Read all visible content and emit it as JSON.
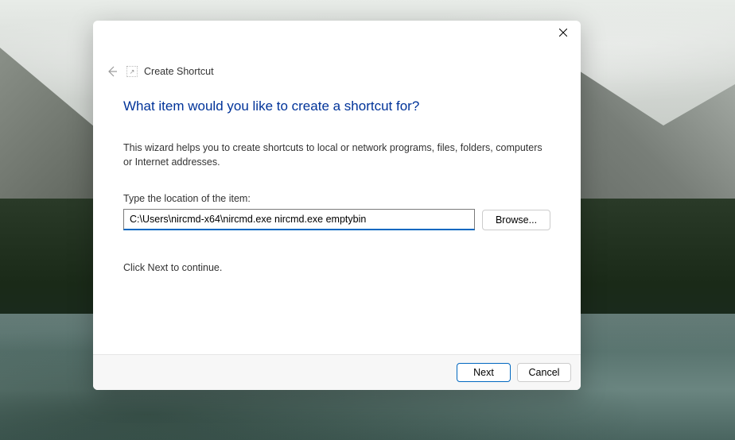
{
  "dialog": {
    "title": "Create Shortcut",
    "heading": "What item would you like to create a shortcut for?",
    "description": "This wizard helps you to create shortcuts to local or network programs, files, folders, computers or Internet addresses.",
    "field_label": "Type the location of the item:",
    "location_value": "C:\\Users\\nircmd-x64\\nircmd.exe nircmd.exe emptybin",
    "browse_label": "Browse...",
    "instruction": "Click Next to continue.",
    "next_label": "Next",
    "cancel_label": "Cancel"
  },
  "colors": {
    "accent": "#0067c0",
    "heading": "#003399"
  }
}
